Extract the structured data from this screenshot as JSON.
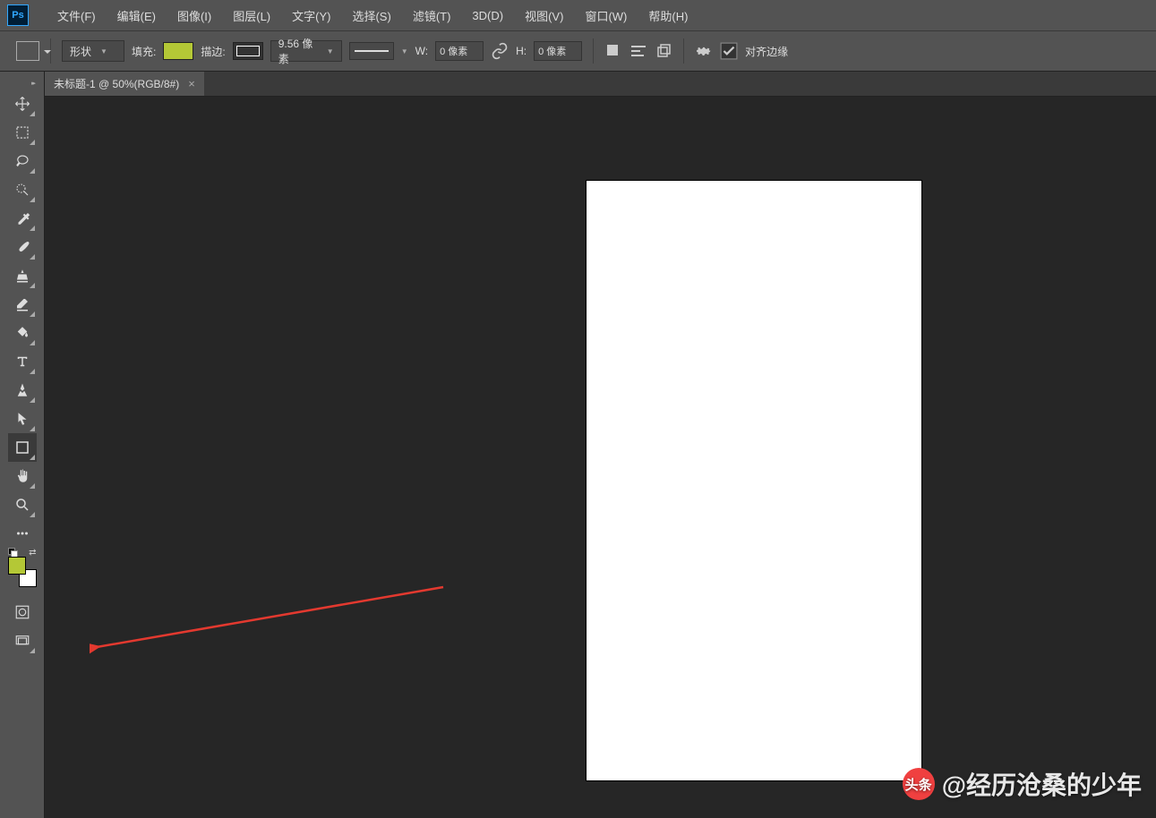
{
  "app": {
    "logo": "Ps"
  },
  "menu": [
    {
      "label": "文件(F)"
    },
    {
      "label": "编辑(E)"
    },
    {
      "label": "图像(I)"
    },
    {
      "label": "图层(L)"
    },
    {
      "label": "文字(Y)"
    },
    {
      "label": "选择(S)"
    },
    {
      "label": "滤镜(T)"
    },
    {
      "label": "3D(D)"
    },
    {
      "label": "视图(V)"
    },
    {
      "label": "窗口(W)"
    },
    {
      "label": "帮助(H)"
    }
  ],
  "options": {
    "mode": "形状",
    "fill_label": "填充:",
    "stroke_label": "描边:",
    "stroke_width": "9.56 像素",
    "w_label": "W:",
    "w_value": "0 像素",
    "h_label": "H:",
    "h_value": "0 像素",
    "align_label": "对齐边缘",
    "fill_color": "#b4c836"
  },
  "doc_tab": {
    "title": "未标题-1 @ 50%(RGB/8#)",
    "close": "×"
  },
  "colors": {
    "fg": "#b4c836",
    "bg": "#ffffff"
  },
  "watermark": {
    "icon": "头条",
    "text": "@经历沧桑的少年"
  }
}
